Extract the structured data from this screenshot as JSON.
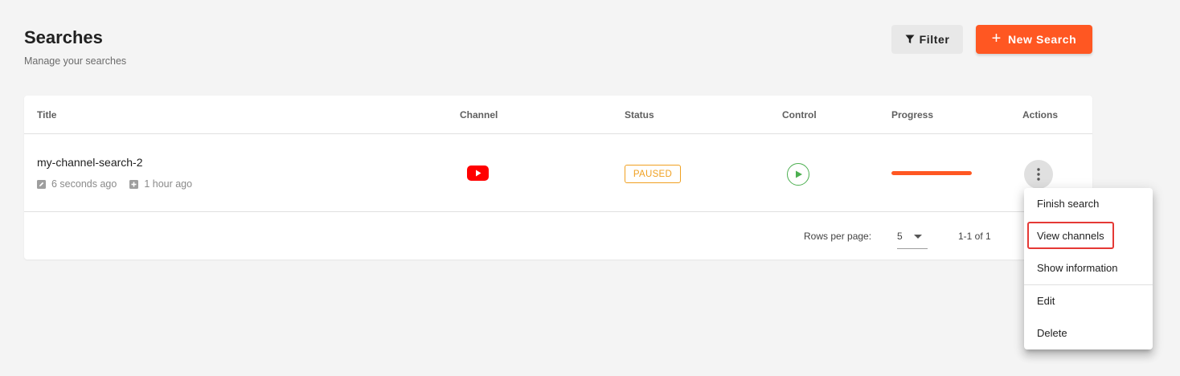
{
  "header": {
    "title": "Searches",
    "subtitle": "Manage your searches",
    "filter_label": "Filter",
    "new_search_label": "New Search"
  },
  "table": {
    "columns": [
      "Title",
      "Channel",
      "Status",
      "Control",
      "Progress",
      "Actions"
    ],
    "rows": [
      {
        "title": "my-channel-search-2",
        "updated": "6 seconds ago",
        "created": "1 hour ago",
        "channel_icon": "youtube-icon",
        "status": "PAUSED",
        "control_icon": "play-icon",
        "progress_percent": 100
      }
    ],
    "footer": {
      "rows_per_page_label": "Rows per page:",
      "rows_per_page_value": "5",
      "page_range": "1-1 of 1"
    }
  },
  "menu": {
    "items": [
      "Finish search",
      "View channels",
      "Show information",
      "Edit",
      "Delete"
    ],
    "highlighted": "View channels"
  },
  "colors": {
    "accent": "#ff5722",
    "status_paused": "#f0a020",
    "play": "#4caf50",
    "youtube": "#ff0000",
    "highlight_box": "#e53935"
  }
}
